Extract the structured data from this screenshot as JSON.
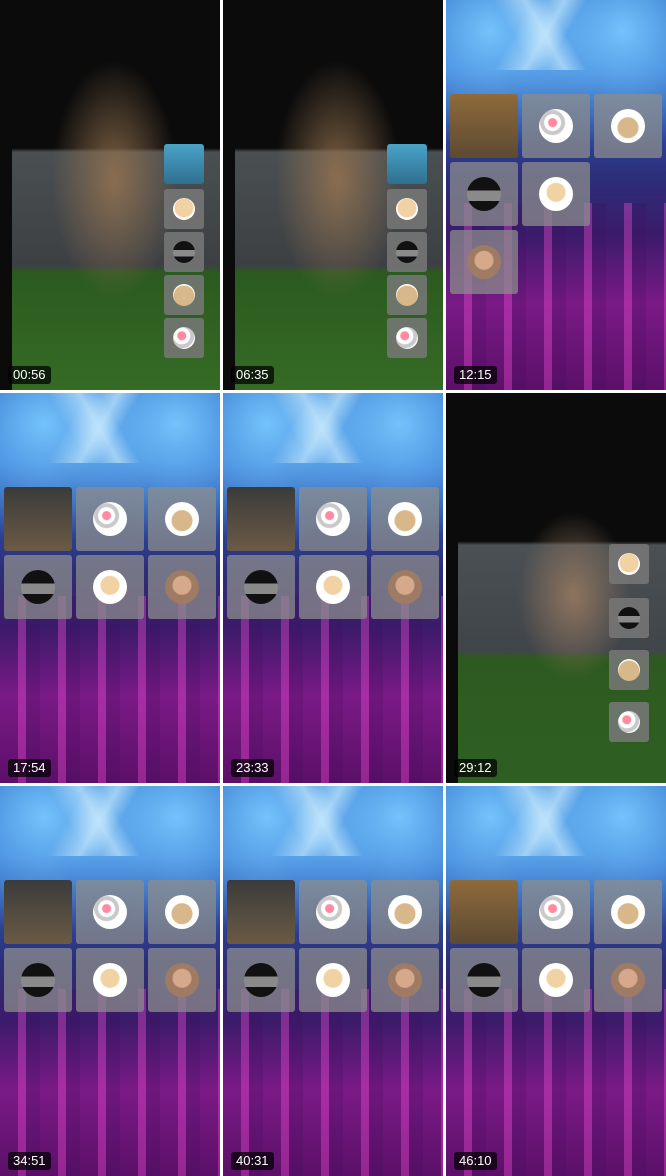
{
  "frames": [
    {
      "time": "00:56"
    },
    {
      "time": "06:35"
    },
    {
      "time": "12:15"
    },
    {
      "time": "17:54"
    },
    {
      "time": "23:33"
    },
    {
      "time": "29:12"
    },
    {
      "time": "34:51"
    },
    {
      "time": "40:31"
    },
    {
      "time": "46:10"
    }
  ]
}
